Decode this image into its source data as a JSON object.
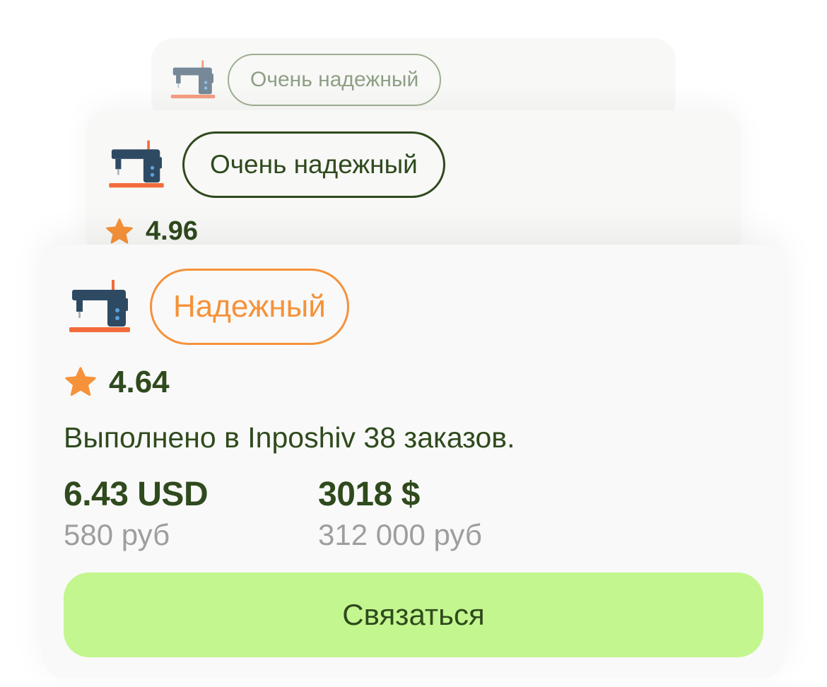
{
  "cards": {
    "back": {
      "badge": "Очень надежный"
    },
    "middle": {
      "badge": "Очень надежный",
      "rating": "4.96"
    },
    "front": {
      "badge": "Надежный",
      "rating": "4.64",
      "orders_text": "Выполнено в Inposhiv 38 заказов.",
      "prices": [
        {
          "main": "6.43 USD",
          "sub": "580 руб"
        },
        {
          "main": "3018 $",
          "sub": "312 000 руб"
        }
      ],
      "contact_label": "Связаться"
    }
  },
  "icons": {
    "machine": "sewing-machine-icon",
    "star": "star-icon"
  },
  "colors": {
    "text_dark_green": "#2f4a1d",
    "badge_orange": "#f5923a",
    "button_green": "#c4f68f",
    "star_orange": "#f5923a",
    "muted_gray": "#9e9e9e"
  }
}
